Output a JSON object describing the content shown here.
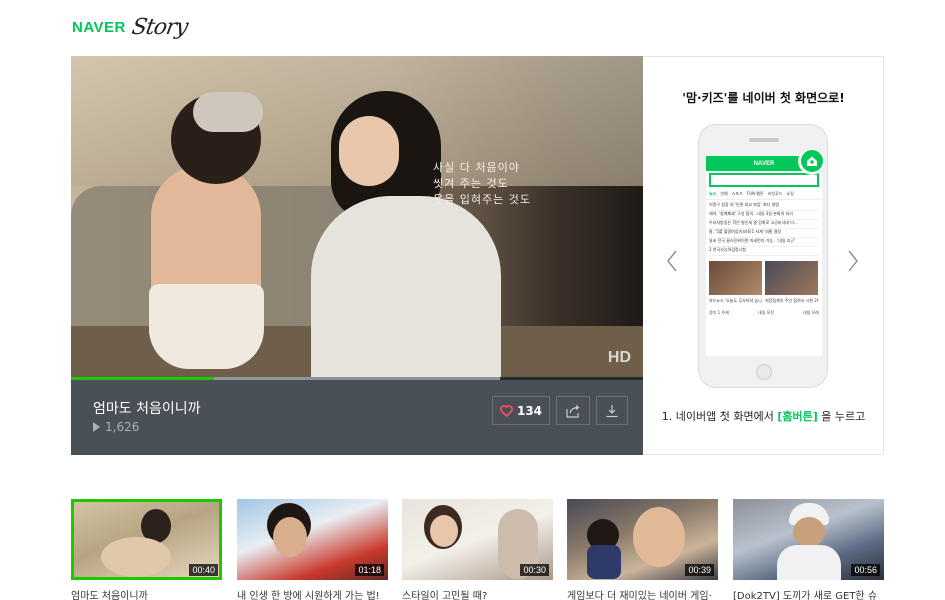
{
  "header": {
    "brand": "NAVER",
    "script_logo": "Story"
  },
  "player": {
    "caption_lines": [
      "사실 다 처음이야",
      "씻겨 주는 것도",
      "옷을 입혀주는 것도"
    ],
    "quality_badge": "HD",
    "progress_fraction": 0.25,
    "buffer_fraction": 0.75,
    "title": "엄마도 처음이니까",
    "views": "1,626",
    "like_count": "134",
    "like_icon": "heart-icon",
    "share_icon": "share-icon",
    "download_icon": "download-icon"
  },
  "promo": {
    "title": "'맘·키즈'를 네이버 첫 화면으로!",
    "step_prefix": "1. 네이버앱 첫 화면에서 ",
    "step_highlight": "[홈버튼]",
    "step_suffix": " 을 누르고",
    "phone": {
      "brand": "NAVER",
      "tabs": [
        "뉴스",
        "연예",
        "스포츠",
        "FUN·웹툰",
        "리빙푸드",
        "쇼핑"
      ],
      "lines": [
        "이명구 청장 외 '민관 외교 파업' 최다 명령",
        "에어, '청계폐쇄' 구성 합의…내달 3일 본회의 처리",
        "우리지방일은 학년 병인세 열 강화로 고공비사대 더…",
        "홍, '5를 불명여업속보(6)1 저계' 외홈 결정",
        "날씨 전국 물러진위이면 미세먼지 기승…'내일 흐근'",
        "2 한국사능력검정시험"
      ],
      "thumb_captions": [
        "카드뉴스 '오늘도 무사하셔 습니까?'",
        "저장집계속 주인 잡혀서 시편 20년 야수, 방점"
      ],
      "bottom_tabs": [
        "정치 1 주제",
        "내일 모전",
        "내일 모레"
      ]
    },
    "left_arrow_icon": "chevron-left-icon",
    "right_arrow_icon": "chevron-right-icon"
  },
  "thumbnails": [
    {
      "label": "엄마도 처음이니까",
      "duration": "00:40",
      "active": true
    },
    {
      "label": "내 인생 한 방에 시원하게 가는 법!",
      "duration": "01:18",
      "active": false
    },
    {
      "label": "스타일이 고민될 때?",
      "duration": "00:30",
      "active": false
    },
    {
      "label": "게임보다 더 재미있는 네이버 게임·",
      "duration": "00:39",
      "active": false
    },
    {
      "label": "[Dok2TV] 도끼가 새로 GET한 슈",
      "duration": "00:56",
      "active": false
    }
  ],
  "colors": {
    "naver_green": "#03c75a",
    "progress_green": "#1ec800",
    "info_bar": "#4a5058",
    "like_heart": "#ff4d5a"
  }
}
